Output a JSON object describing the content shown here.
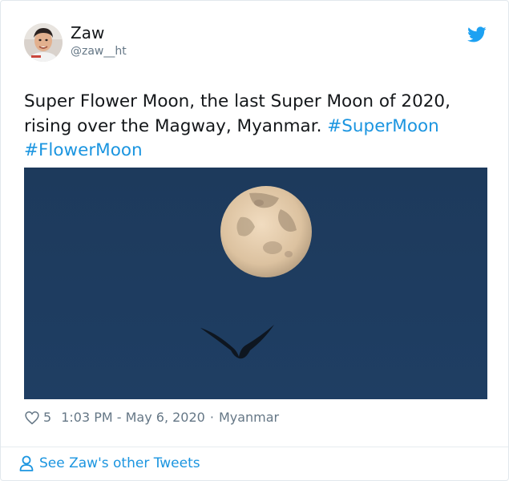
{
  "author": {
    "display_name": "Zaw",
    "handle": "@zaw__ht"
  },
  "tweet": {
    "text_main": "Super Flower Moon, the last Super Moon of 2020, rising over the Magway, Myanmar.",
    "hashtags": [
      "#SuperMoon",
      "#FlowerMoon"
    ]
  },
  "meta": {
    "like_count": "5",
    "timestamp": "1:03 PM - May 6, 2020",
    "separator": "·",
    "location": "Myanmar"
  },
  "footer": {
    "see_more_label": "See Zaw's other Tweets"
  },
  "icons": {
    "brand": "twitter-bird-icon",
    "like": "heart-icon",
    "profile": "person-icon"
  },
  "colors": {
    "link": "#1b95e0",
    "secondary_text": "#657786",
    "twitter_blue": "#1da1f2",
    "sky": "#1d3a5c"
  }
}
